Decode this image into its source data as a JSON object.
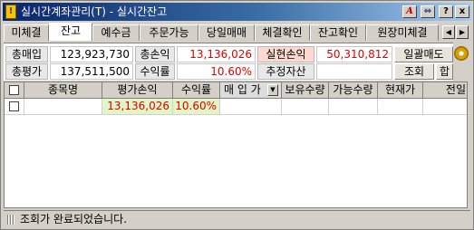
{
  "window": {
    "title": "실시간계좌관리(T) - 실시간잔고",
    "title_icon": "document-icon",
    "buttons": {
      "a": "A",
      "pin": "⇔",
      "help": "?",
      "close": "x"
    }
  },
  "tabs": {
    "items": [
      "미체결",
      "잔고",
      "예수금",
      "주문가능",
      "당일매매",
      "체결확인",
      "잔고확인",
      "원장미체결"
    ],
    "active": "잔고",
    "scroll_left": "◀",
    "scroll_right": "▶"
  },
  "summary": {
    "total_buy_label": "총매입",
    "total_buy_value": "123,923,730",
    "total_pl_label": "총손익",
    "total_pl_value": "13,136,026",
    "realized_label": "실현손익",
    "realized_value": "50,310,812",
    "sell_all_button": "일괄매도",
    "total_eval_label": "총평가",
    "total_eval_value": "137,511,500",
    "return_label": "수익률",
    "return_value": "10.60%",
    "estimated_label": "추정자산",
    "estimated_value": "",
    "query_button": "조회",
    "sum_button": "합"
  },
  "grid": {
    "columns": [
      "종목명",
      "평가손익",
      "수익률",
      "매 입 가",
      "보유수량",
      "가능수량",
      "현재가",
      "전일"
    ],
    "rows": [
      {
        "name": "",
        "eval_pl": "13,136,026",
        "return": "10.60%",
        "buy_price": "",
        "holding": "",
        "available": "",
        "current": "",
        "prev": ""
      }
    ]
  },
  "status": {
    "message": "조회가 완료되었습니다."
  },
  "colors": {
    "accent_red": "#e00000",
    "highlight_green": "#e2f5c6",
    "title_blue": "#0a246a"
  }
}
